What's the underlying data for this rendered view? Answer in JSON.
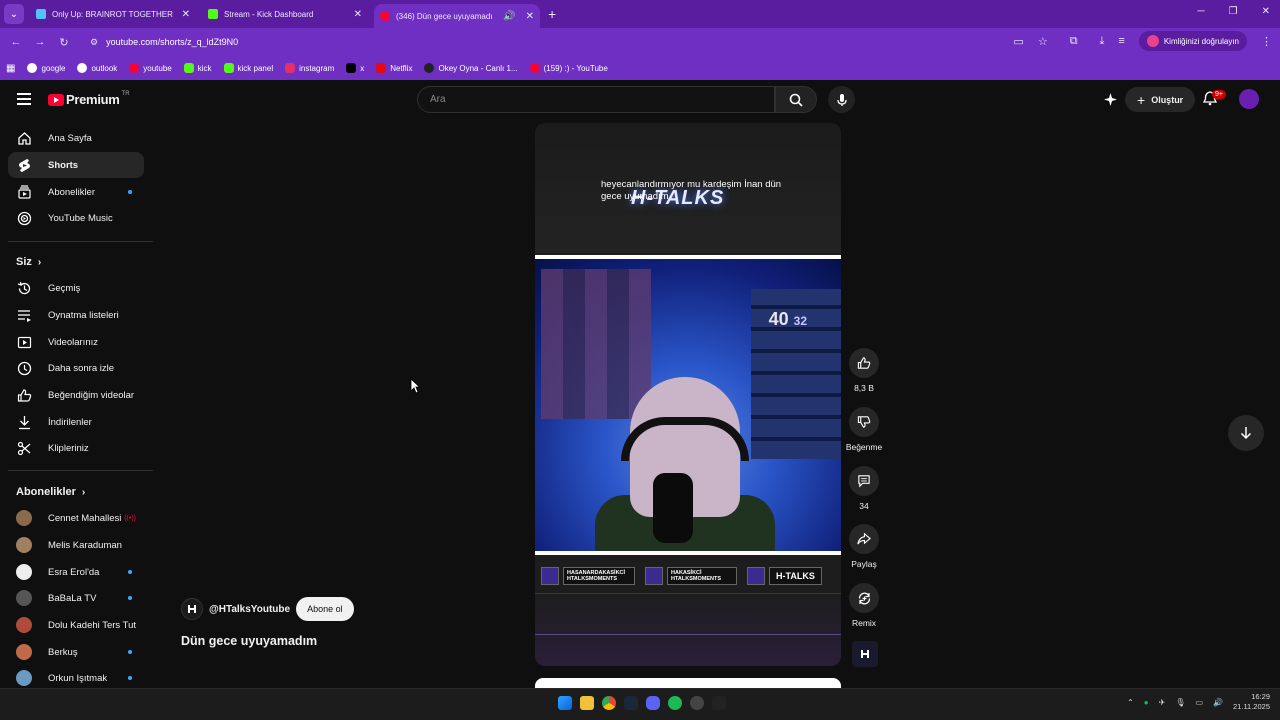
{
  "browser": {
    "tabs": [
      {
        "title": "Only Up: BRAINROT TOGETHER",
        "favicon_color": "#4fc3f7",
        "active": false
      },
      {
        "title": "Stream - Kick Dashboard",
        "favicon_color": "#53fc18",
        "active": false
      },
      {
        "title": "(346) Dün gece uyuyamadı",
        "favicon_color": "#ff0033",
        "active": true
      }
    ],
    "url": "youtube.com/shorts/z_q_ldZt9N0",
    "verify_label": "Kimliğinizi doğrulayın",
    "bookmarks": [
      {
        "label": "google",
        "color": "#ffffff"
      },
      {
        "label": "outlook",
        "color": "#ffffff"
      },
      {
        "label": "youtube",
        "color": "#ff0033"
      },
      {
        "label": "kick",
        "color": "#53fc18"
      },
      {
        "label": "kick panel",
        "color": "#53fc18"
      },
      {
        "label": "instagram",
        "color": "#e1306c"
      },
      {
        "label": "x",
        "color": "#000000"
      },
      {
        "label": "Netflix",
        "color": "#e50914"
      },
      {
        "label": "Okey Oyna - Canlı 1...",
        "color": "#222222"
      },
      {
        "label": "(159) :) - YouTube",
        "color": "#ff0033"
      }
    ]
  },
  "youtube": {
    "logo_text": "Premium",
    "logo_region": "TR",
    "search_placeholder": "Ara",
    "create_label": "Oluştur",
    "notif_count": "9+",
    "sidebar": {
      "main": [
        {
          "label": "Ana Sayfa",
          "icon": "home-icon"
        },
        {
          "label": "Shorts",
          "icon": "shorts-icon"
        },
        {
          "label": "Abonelikler",
          "icon": "subscriptions-icon"
        },
        {
          "label": "YouTube Music",
          "icon": "music-icon"
        }
      ],
      "you_heading": "Siz",
      "you": [
        {
          "label": "Geçmiş",
          "icon": "history-icon"
        },
        {
          "label": "Oynatma listeleri",
          "icon": "playlist-icon"
        },
        {
          "label": "Videolarınız",
          "icon": "your-videos-icon"
        },
        {
          "label": "Daha sonra izle",
          "icon": "watch-later-icon"
        },
        {
          "label": "Beğendiğim videolar",
          "icon": "like-icon"
        },
        {
          "label": "İndirilenler",
          "icon": "download-icon"
        },
        {
          "label": "Klipleriniz",
          "icon": "clips-icon"
        }
      ],
      "subs_heading": "Abonelikler",
      "subscriptions": [
        {
          "label": "Cennet Mahallesi",
          "avatar_color": "#8a6a4a",
          "indicator": "live"
        },
        {
          "label": "Melis Karaduman",
          "avatar_color": "#a08060",
          "indicator": "none"
        },
        {
          "label": "Esra Erol'da",
          "avatar_color": "#eeeeee",
          "indicator": "dot"
        },
        {
          "label": "BaBaLa TV",
          "avatar_color": "#555555",
          "indicator": "dot"
        },
        {
          "label": "Dolu Kadehi Ters Tut",
          "avatar_color": "#b04a3a",
          "indicator": "none"
        },
        {
          "label": "Berkuş",
          "avatar_color": "#c06a4a",
          "indicator": "dot"
        },
        {
          "label": "Orkun Işıtmak",
          "avatar_color": "#6a9ac0",
          "indicator": "dot"
        }
      ]
    },
    "short": {
      "caption": "heyecanlandırmıyor mu kardeşim İnan dün gece uyumadım",
      "overlay_logo": "H-TALKS",
      "jersey_left": "40",
      "jersey_right": "32",
      "socials": [
        {
          "text": "HASANARDAKASİKCİ HTALKSMOMENTS"
        },
        {
          "text": "HAKASİKCİ HTALKSMOMENTS"
        }
      ],
      "social_brand": "H-TALKS",
      "channel": "@HTalksYoutube",
      "subscribe": "Abone ol",
      "title": "Dün gece uyuyamadım"
    },
    "actions": {
      "likes": "8,3 B",
      "dislike": "Beğenme",
      "comments": "34",
      "share": "Paylaş",
      "remix": "Remix"
    }
  },
  "taskbar": {
    "time": "16:29",
    "date": "21.11.2025"
  }
}
